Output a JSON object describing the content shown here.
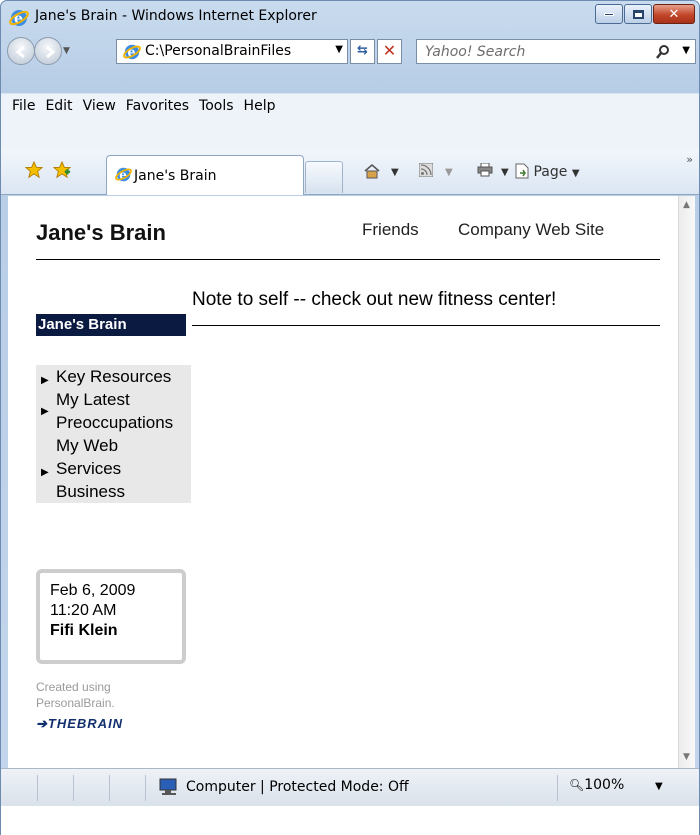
{
  "window": {
    "title": "Jane's Brain - Windows Internet Explorer"
  },
  "nav": {
    "address": "C:\\PersonalBrainFiles",
    "search_placeholder": "Yahoo! Search"
  },
  "menu": [
    "File",
    "Edit",
    "View",
    "Favorites",
    "Tools",
    "Help"
  ],
  "tabs": {
    "active_label": "Jane's Brain",
    "page_menu_label": "Page"
  },
  "page": {
    "title": "Jane's Brain",
    "top_links": [
      "Friends",
      "Company Web Site"
    ],
    "note": "Note to self -- check out new fitness center!",
    "brain_label": "Jane's Brain",
    "side_items": [
      {
        "lines": [
          "Key Resources"
        ]
      },
      {
        "lines": [
          "My Latest",
          "Preoccupations"
        ]
      },
      {
        "lines": [
          "My Web",
          "Services",
          "Business"
        ]
      }
    ],
    "date": "Feb 6, 2009",
    "time": "11:20 AM",
    "author": "Fifi Klein",
    "created_line1": "Created using",
    "created_line2": "PersonalBrain.",
    "logo_text": "THEBRAIN"
  },
  "status": {
    "zone_text": "Computer | Protected Mode: Off",
    "zoom": "100%"
  },
  "colors": {
    "brain_box_bg": "#0b1a40",
    "side_bg": "#e8e8e8",
    "logo": "#12306e"
  }
}
